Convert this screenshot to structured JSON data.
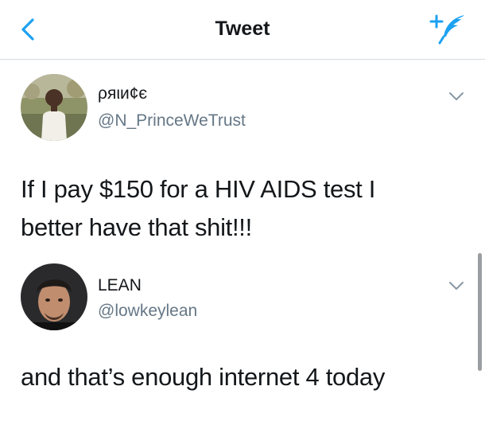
{
  "header": {
    "title": "Tweet",
    "back_icon": "chevron-left-icon",
    "compose_icon": "compose-tweet-icon",
    "accent_color": "#1da1f2"
  },
  "tweets": [
    {
      "display_name": "ρяιи¢є",
      "handle": "@N_PrinceWeTrust",
      "text_lines": [
        "If I pay $150 for a HIV AIDS test I",
        "better have that shit!!!"
      ],
      "menu_icon": "chevron-down-icon"
    },
    {
      "display_name": "LEAN",
      "handle": "@lowkeylean",
      "text_lines": [
        "and that’s enough internet 4 today"
      ],
      "menu_icon": "chevron-down-icon"
    }
  ]
}
